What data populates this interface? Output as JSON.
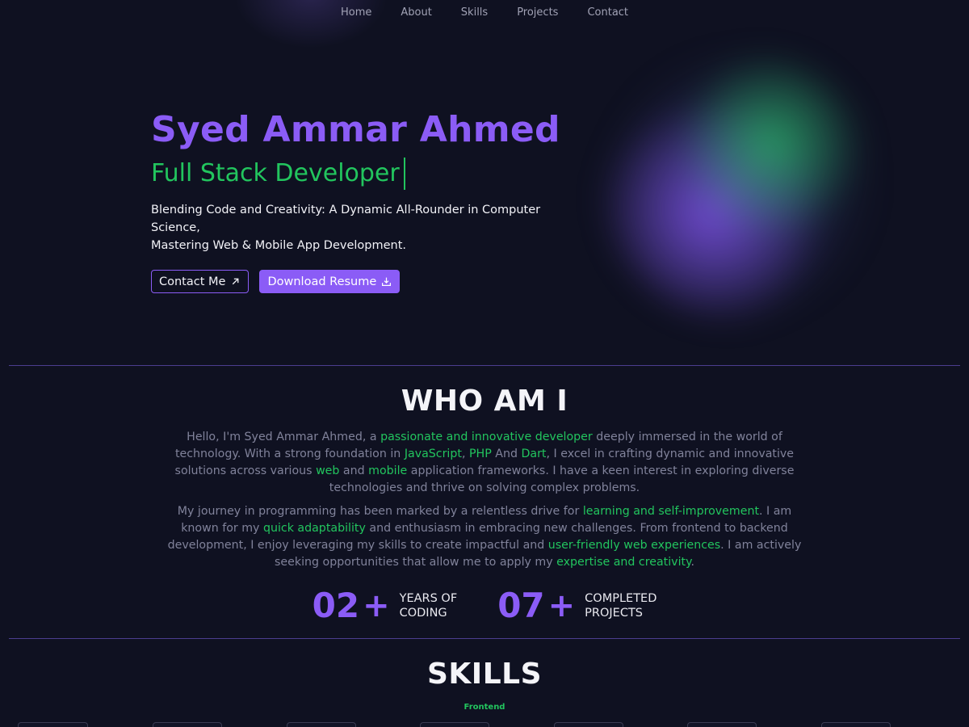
{
  "nav": {
    "items": [
      "Home",
      "About",
      "Skills",
      "Projects",
      "Contact"
    ]
  },
  "hero": {
    "name": "Syed Ammar Ahmed",
    "role": "Full Stack Developer",
    "tagline_line1": "Blending Code and Creativity: A Dynamic All-Rounder in Computer Science,",
    "tagline_line2": "Mastering Web & Mobile App Development.",
    "contact_label": "Contact Me",
    "resume_label": "Download Resume"
  },
  "about": {
    "title": "WHO AM I",
    "p1": [
      {
        "t": "Hello, I'm Syed Ammar Ahmed, a ",
        "hl": false
      },
      {
        "t": "passionate and innovative developer",
        "hl": true
      },
      {
        "t": " deeply immersed in the world of technology. With a strong foundation in ",
        "hl": false
      },
      {
        "t": "JavaScript",
        "hl": true
      },
      {
        "t": ", ",
        "hl": false
      },
      {
        "t": "PHP",
        "hl": true
      },
      {
        "t": " And ",
        "hl": false
      },
      {
        "t": "Dart",
        "hl": true
      },
      {
        "t": ", I excel in crafting dynamic and innovative solutions across various ",
        "hl": false
      },
      {
        "t": "web",
        "hl": true
      },
      {
        "t": " and ",
        "hl": false
      },
      {
        "t": "mobile",
        "hl": true
      },
      {
        "t": " application frameworks. I have a keen interest in exploring diverse technologies and thrive on solving complex problems.",
        "hl": false
      }
    ],
    "p2": [
      {
        "t": "My journey in programming has been marked by a relentless drive for ",
        "hl": false
      },
      {
        "t": "learning and self-improvement",
        "hl": true
      },
      {
        "t": ". I am known for my ",
        "hl": false
      },
      {
        "t": "quick adaptability",
        "hl": true
      },
      {
        "t": " and enthusiasm in embracing new challenges. From frontend to backend development, I enjoy leveraging my skills to create impactful and ",
        "hl": false
      },
      {
        "t": "user-friendly web experiences",
        "hl": true
      },
      {
        "t": ". I am actively seeking opportunities that allow me to apply my ",
        "hl": false
      },
      {
        "t": "expertise and creativity",
        "hl": true
      },
      {
        "t": ".",
        "hl": false
      }
    ],
    "stats": [
      {
        "num": "02",
        "plus": "+",
        "line1": "Years of",
        "line2": "Coding"
      },
      {
        "num": "07",
        "plus": "+",
        "line1": "Completed",
        "line2": "Projects"
      }
    ]
  },
  "skills": {
    "title": "SKILLS",
    "subhead": "Frontend"
  },
  "colors": {
    "accent": "#8b5cf6",
    "highlight": "#22c55e",
    "background": "#0f1121"
  }
}
